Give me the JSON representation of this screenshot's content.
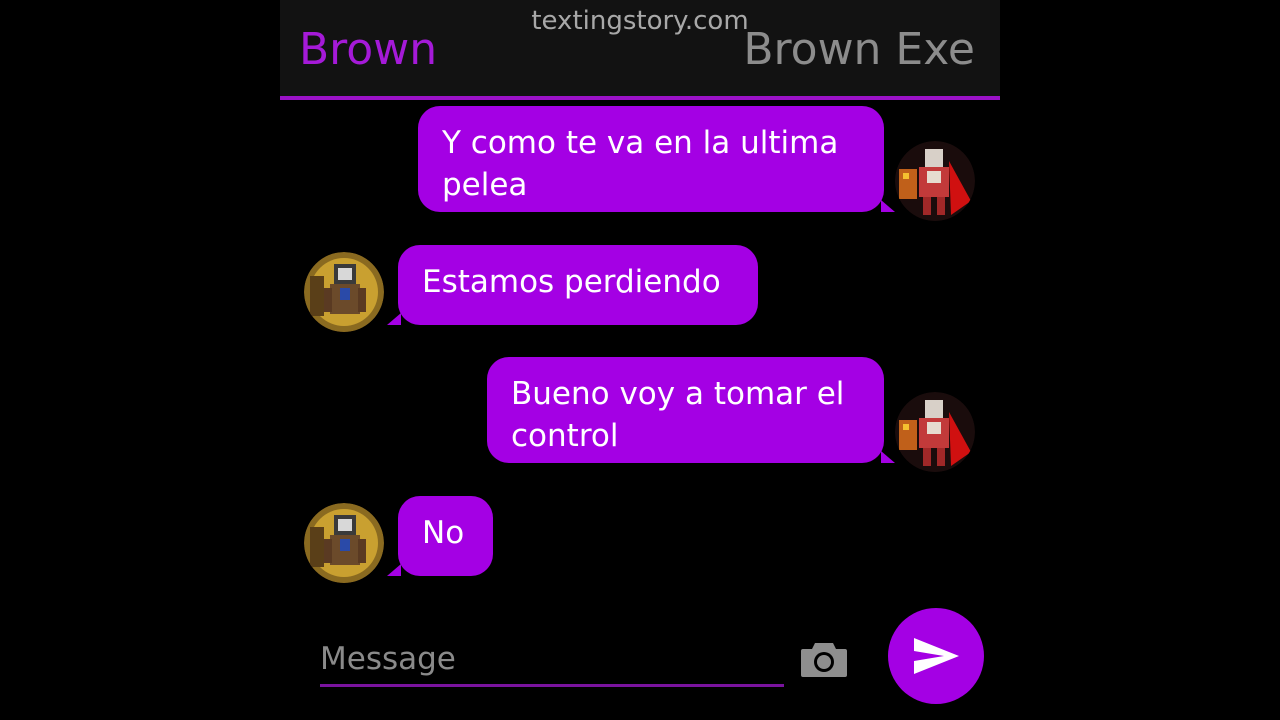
{
  "watermark": "textingstory.com",
  "header": {
    "left_name": "Brown",
    "right_name": "Brown Exe"
  },
  "messages": [
    {
      "side": "right",
      "text": "Y como te va en la ultima pelea"
    },
    {
      "side": "left",
      "text": "Estamos perdiendo"
    },
    {
      "side": "right",
      "text": "Bueno voy a tomar el control"
    },
    {
      "side": "left",
      "text": "No"
    }
  ],
  "composer": {
    "placeholder": "Message"
  },
  "icons": {
    "camera": "camera-icon",
    "send": "send-icon"
  },
  "colors": {
    "accent": "#a400e4",
    "header_bg": "#121212",
    "left_name": "#a51ad8",
    "right_name": "#8c8c8c"
  }
}
